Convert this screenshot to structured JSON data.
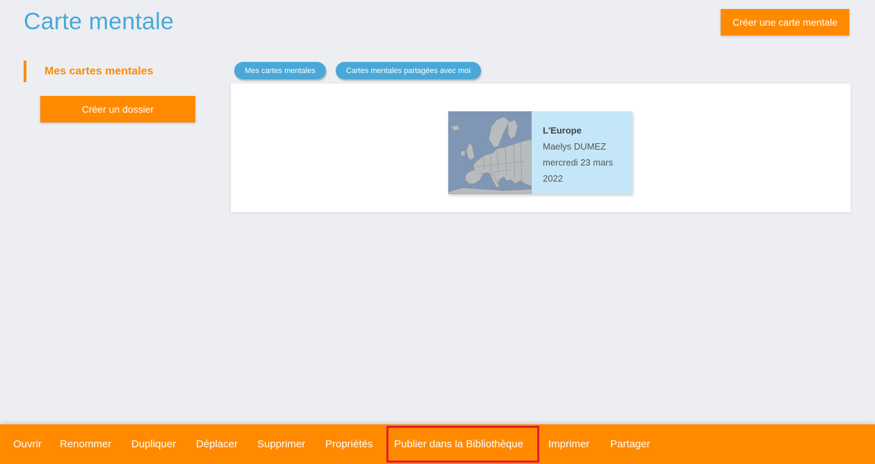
{
  "header": {
    "title": "Carte mentale",
    "create_map_label": "Créer une carte mentale"
  },
  "sidebar": {
    "active_item": "Mes cartes mentales",
    "create_folder_label": "Créer un dossier"
  },
  "tabs": [
    {
      "label": "Mes cartes mentales"
    },
    {
      "label": "Cartes mentales partagées avec moi"
    }
  ],
  "cards": [
    {
      "title": "L'Europe",
      "author": "Maelys DUMEZ",
      "date": "mercredi 23 mars 2022",
      "thumbnail": "europe-map-icon"
    }
  ],
  "actions": [
    {
      "label": "Ouvrir"
    },
    {
      "label": "Renommer"
    },
    {
      "label": "Dupliquer"
    },
    {
      "label": "Déplacer"
    },
    {
      "label": "Supprimer"
    },
    {
      "label": "Propriétés"
    },
    {
      "label": "Publier dans la Bibliothèque",
      "highlighted": true
    },
    {
      "label": "Imprimer"
    },
    {
      "label": "Partager"
    }
  ],
  "colors": {
    "accent_orange": "#ff8a00",
    "accent_blue": "#4aa8d8",
    "card_bg": "#c5e6f8",
    "highlight_border": "#e8192c",
    "page_bg": "#edeef2"
  }
}
